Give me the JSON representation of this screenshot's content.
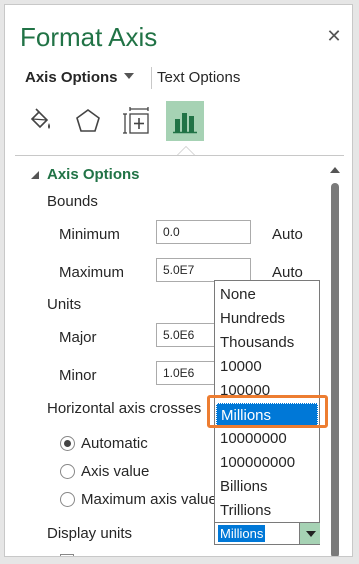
{
  "pane": {
    "title": "Format Axis",
    "close_label": "✕"
  },
  "tabs": {
    "axis_options": "Axis Options",
    "text_options": "Text Options"
  },
  "icons": [
    "fill-line-icon",
    "effects-icon",
    "size-properties-icon",
    "axis-options-icon"
  ],
  "section": {
    "title": "Axis Options"
  },
  "bounds": {
    "label": "Bounds",
    "minimum_label": "Minimum",
    "minimum_value": "0.0",
    "minimum_mode": "Auto",
    "maximum_label": "Maximum",
    "maximum_value": "5.0E7",
    "maximum_mode": "Auto"
  },
  "units": {
    "label": "Units",
    "major_label": "Major",
    "major_value": "5.0E6",
    "minor_label": "Minor",
    "minor_value": "1.0E6"
  },
  "crosses": {
    "label": "Horizontal axis crosses",
    "options": [
      "Automatic",
      "Axis value",
      "Maximum axis value"
    ],
    "selected": "Automatic"
  },
  "display_units": {
    "label": "Display units",
    "value": "Millions",
    "options": [
      "None",
      "Hundreds",
      "Thousands",
      "10000",
      "100000",
      "Millions",
      "10000000",
      "100000000",
      "Billions",
      "Trillions"
    ],
    "highlighted": "Millions"
  },
  "colors": {
    "accent": "#217346",
    "selection": "#0078d7",
    "callout": "#ed7d31"
  }
}
